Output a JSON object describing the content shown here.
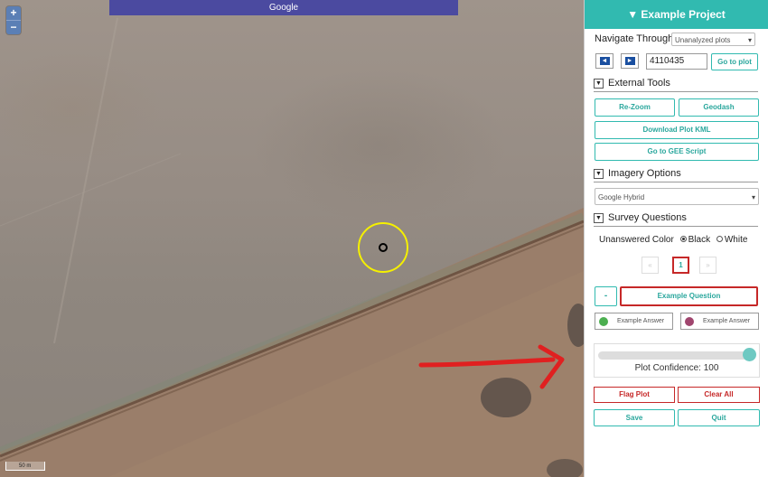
{
  "map": {
    "title": "Google",
    "zoom_in_label": "+",
    "zoom_out_label": "−",
    "scale_label": "50 m"
  },
  "panel": {
    "project_title": "▼ Example Project",
    "navigate_label": "Navigate Through:",
    "navigate_value": "Unanalyzed plots",
    "prev_label": "◄",
    "next_label": "►",
    "plot_id": "4110435",
    "goto_plot_label": "Go to plot",
    "sections": {
      "external_tools": "External Tools",
      "imagery_options": "Imagery Options",
      "survey_questions": "Survey Questions"
    },
    "toggle_glyph": "▼",
    "tools": {
      "rezoom": "Re-Zoom",
      "geodash": "Geodash",
      "download_kml": "Download Plot KML",
      "gee_script": "Go to GEE Script"
    },
    "imagery_value": "Google Hybrid",
    "unanswered_color_label": "Unanswered Color",
    "color_options": [
      "Black",
      "White"
    ],
    "color_selected": "Black",
    "pager": {
      "prev": "«",
      "current": "1",
      "next": "»"
    },
    "question": {
      "collapse": "-",
      "label": "Example Question"
    },
    "answers": [
      {
        "label": "Example Answer",
        "color": "#4caf50"
      },
      {
        "label": "Example Answer",
        "color": "#a0456e"
      }
    ],
    "confidence": {
      "label": "Plot Confidence: 100",
      "value": 100
    },
    "actions": {
      "flag": "Flag Plot",
      "clear": "Clear All",
      "save": "Save",
      "quit": "Quit"
    }
  },
  "colors": {
    "accent": "#31bab0",
    "danger": "#c62828",
    "map_title_bg": "#4b4aa0",
    "annotation_arrow": "#e02020"
  }
}
